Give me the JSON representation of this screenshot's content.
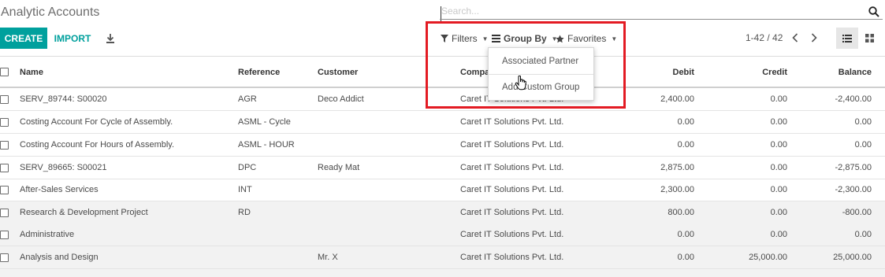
{
  "page": {
    "title": "Analytic Accounts"
  },
  "search": {
    "placeholder": "Search..."
  },
  "toolbar": {
    "create_label": "CREATE",
    "import_label": "IMPORT"
  },
  "searchpanel": {
    "filters_label": "Filters",
    "groupby_label": "Group By",
    "favorites_label": "Favorites"
  },
  "groupby_menu": {
    "items": [
      "Associated Partner",
      "Add Custom Group"
    ]
  },
  "pager": {
    "value": "1-42 / 42"
  },
  "table": {
    "columns": [
      "Name",
      "Reference",
      "Customer",
      "Company",
      "Debit",
      "Credit",
      "Balance"
    ],
    "rows": [
      {
        "name": "SERV_89744: S00020",
        "reference": "AGR",
        "customer": "Deco Addict",
        "company": "Caret IT Solutions Pvt. Ltd.",
        "debit": "2,400.00",
        "credit": "0.00",
        "balance": "-2,400.00"
      },
      {
        "name": "Costing Account For Cycle of Assembly.",
        "reference": "ASML - Cycle",
        "customer": "",
        "company": "Caret IT Solutions Pvt. Ltd.",
        "debit": "0.00",
        "credit": "0.00",
        "balance": "0.00"
      },
      {
        "name": "Costing Account For Hours of Assembly.",
        "reference": "ASML - HOUR",
        "customer": "",
        "company": "Caret IT Solutions Pvt. Ltd.",
        "debit": "0.00",
        "credit": "0.00",
        "balance": "0.00"
      },
      {
        "name": "SERV_89665: S00021",
        "reference": "DPC",
        "customer": "Ready Mat",
        "company": "Caret IT Solutions Pvt. Ltd.",
        "debit": "2,875.00",
        "credit": "0.00",
        "balance": "-2,875.00"
      },
      {
        "name": "After-Sales Services",
        "reference": "INT",
        "customer": "",
        "company": "Caret IT Solutions Pvt. Ltd.",
        "debit": "2,300.00",
        "credit": "0.00",
        "balance": "-2,300.00"
      },
      {
        "name": "Research & Development Project",
        "reference": "RD",
        "customer": "",
        "company": "Caret IT Solutions Pvt. Ltd.",
        "debit": "800.00",
        "credit": "0.00",
        "balance": "-800.00"
      },
      {
        "name": "Administrative",
        "reference": "",
        "customer": "",
        "company": "Caret IT Solutions Pvt. Ltd.",
        "debit": "0.00",
        "credit": "0.00",
        "balance": "0.00"
      },
      {
        "name": "Analysis and Design",
        "reference": "",
        "customer": "Mr. X",
        "company": "Caret IT Solutions Pvt. Ltd.",
        "debit": "0.00",
        "credit": "25,000.00",
        "balance": "25,000.00"
      }
    ]
  },
  "colors": {
    "accent": "#00a09d",
    "highlight_box": "#e31b23"
  },
  "icons": [
    "search-icon",
    "download-icon",
    "filter-icon",
    "group-by-icon",
    "star-icon",
    "chevron-left-icon",
    "chevron-right-icon",
    "list-view-icon",
    "kanban-view-icon",
    "hand-cursor-icon"
  ]
}
